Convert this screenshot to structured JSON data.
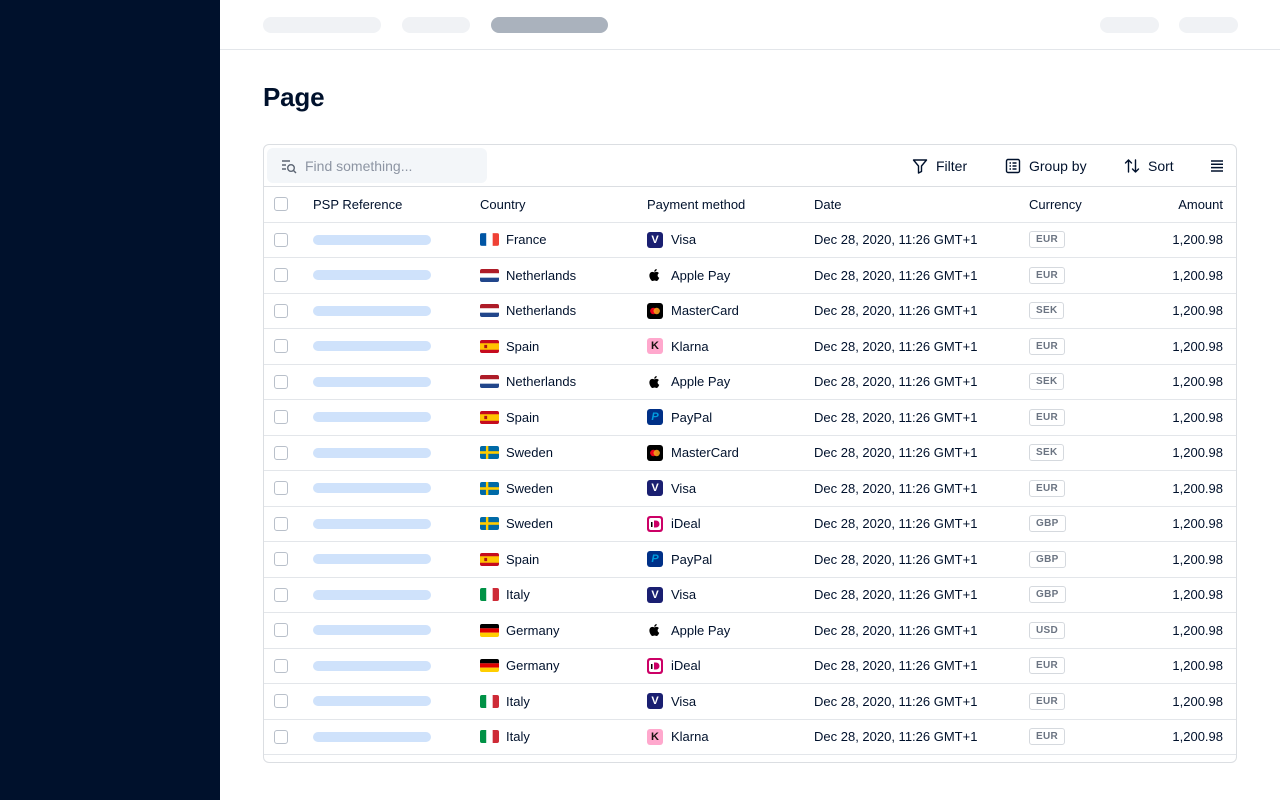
{
  "page": {
    "title": "Page"
  },
  "toolbar": {
    "search_placeholder": "Find something...",
    "filter_label": "Filter",
    "group_label": "Group by",
    "sort_label": "Sort"
  },
  "table": {
    "columns": {
      "psp": "PSP Reference",
      "country": "Country",
      "method": "Payment method",
      "date": "Date",
      "currency": "Currency",
      "amount": "Amount"
    },
    "rows": [
      {
        "country": "France",
        "flag": "fr",
        "method": "Visa",
        "method_icon": "visa",
        "date": "Dec 28, 2020, 11:26 GMT+1",
        "currency": "EUR",
        "amount": "1,200.98"
      },
      {
        "country": "Netherlands",
        "flag": "nl",
        "method": "Apple Pay",
        "method_icon": "applepay",
        "date": "Dec 28, 2020, 11:26 GMT+1",
        "currency": "EUR",
        "amount": "1,200.98"
      },
      {
        "country": "Netherlands",
        "flag": "nl",
        "method": "MasterCard",
        "method_icon": "mastercard",
        "date": "Dec 28, 2020, 11:26 GMT+1",
        "currency": "SEK",
        "amount": "1,200.98"
      },
      {
        "country": "Spain",
        "flag": "es",
        "method": "Klarna",
        "method_icon": "klarna",
        "date": "Dec 28, 2020, 11:26 GMT+1",
        "currency": "EUR",
        "amount": "1,200.98"
      },
      {
        "country": "Netherlands",
        "flag": "nl",
        "method": "Apple Pay",
        "method_icon": "applepay",
        "date": "Dec 28, 2020, 11:26 GMT+1",
        "currency": "SEK",
        "amount": "1,200.98"
      },
      {
        "country": "Spain",
        "flag": "es",
        "method": "PayPal",
        "method_icon": "paypal",
        "date": "Dec 28, 2020, 11:26 GMT+1",
        "currency": "EUR",
        "amount": "1,200.98"
      },
      {
        "country": "Sweden",
        "flag": "se",
        "method": "MasterCard",
        "method_icon": "mastercard",
        "date": "Dec 28, 2020, 11:26 GMT+1",
        "currency": "SEK",
        "amount": "1,200.98"
      },
      {
        "country": "Sweden",
        "flag": "se",
        "method": "Visa",
        "method_icon": "visa",
        "date": "Dec 28, 2020, 11:26 GMT+1",
        "currency": "EUR",
        "amount": "1,200.98"
      },
      {
        "country": "Sweden",
        "flag": "se",
        "method": "iDeal",
        "method_icon": "ideal",
        "date": "Dec 28, 2020, 11:26 GMT+1",
        "currency": "GBP",
        "amount": "1,200.98"
      },
      {
        "country": "Spain",
        "flag": "es",
        "method": "PayPal",
        "method_icon": "paypal",
        "date": "Dec 28, 2020, 11:26 GMT+1",
        "currency": "GBP",
        "amount": "1,200.98"
      },
      {
        "country": "Italy",
        "flag": "it",
        "method": "Visa",
        "method_icon": "visa",
        "date": "Dec 28, 2020, 11:26 GMT+1",
        "currency": "GBP",
        "amount": "1,200.98"
      },
      {
        "country": "Germany",
        "flag": "de",
        "method": "Apple Pay",
        "method_icon": "applepay",
        "date": "Dec 28, 2020, 11:26 GMT+1",
        "currency": "USD",
        "amount": "1,200.98"
      },
      {
        "country": "Germany",
        "flag": "de",
        "method": "iDeal",
        "method_icon": "ideal",
        "date": "Dec 28, 2020, 11:26 GMT+1",
        "currency": "EUR",
        "amount": "1,200.98"
      },
      {
        "country": "Italy",
        "flag": "it",
        "method": "Visa",
        "method_icon": "visa",
        "date": "Dec 28, 2020, 11:26 GMT+1",
        "currency": "EUR",
        "amount": "1,200.98"
      },
      {
        "country": "Italy",
        "flag": "it",
        "method": "Klarna",
        "method_icon": "klarna",
        "date": "Dec 28, 2020, 11:26 GMT+1",
        "currency": "EUR",
        "amount": "1,200.98"
      }
    ]
  },
  "colors": {
    "sidebar": "#00112c",
    "accent_placeholder": "#cfe2fb"
  }
}
